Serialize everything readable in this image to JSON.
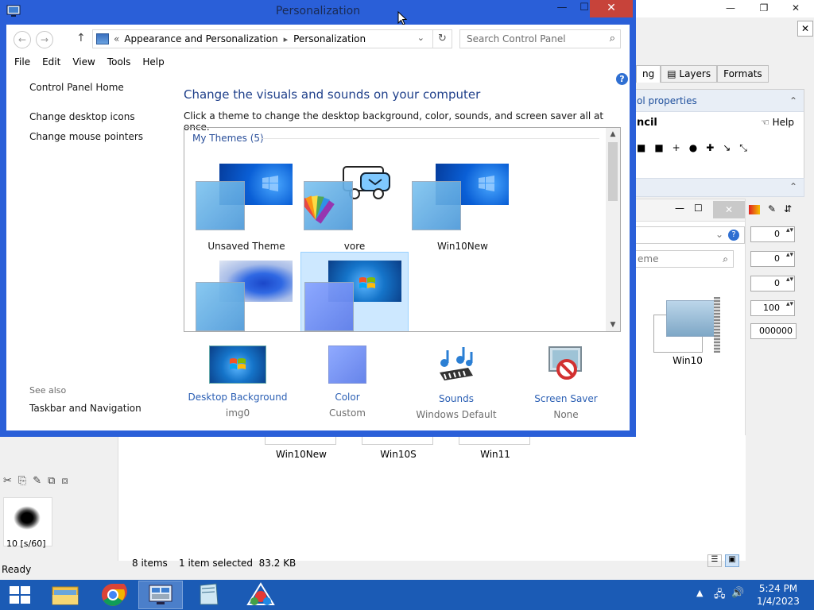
{
  "window": {
    "title": "Personalization",
    "minimize": "—",
    "maximize": "☐",
    "close": "✕"
  },
  "address": {
    "chevrons": "«",
    "crumbs": [
      "Appearance and Personalization",
      "Personalization"
    ],
    "separator": "▸",
    "search_placeholder": "Search Control Panel"
  },
  "menu": [
    "File",
    "Edit",
    "View",
    "Tools",
    "Help"
  ],
  "leftnav": {
    "home": "Control Panel Home",
    "links": [
      "Change desktop icons",
      "Change mouse pointers"
    ],
    "see_also": "See also",
    "see_also_link": "Taskbar and Navigation"
  },
  "main": {
    "heading": "Change the visuals and sounds on your computer",
    "subheading": "Click a theme to change the desktop background, color, sounds, and screen saver all at once.",
    "group_label": "My Themes (5)",
    "themes": [
      {
        "name": "Unsaved Theme"
      },
      {
        "name": "vore"
      },
      {
        "name": "Win10New"
      },
      {
        "name": ""
      },
      {
        "name": ""
      }
    ]
  },
  "bottom": [
    {
      "label": "Desktop Background",
      "sub": "img0"
    },
    {
      "label": "Color",
      "sub": "Custom"
    },
    {
      "label": "Sounds",
      "sub": "Windows Default"
    },
    {
      "label": "Screen Saver",
      "sub": "None"
    }
  ],
  "background_app": {
    "tabs": [
      "ng",
      "Layers",
      "Formats"
    ],
    "panel_title": "ol properties",
    "tool_name": "ncil",
    "help": "Help",
    "search_placeholder": "eme",
    "spin_values": [
      "0",
      "0",
      "0",
      "100"
    ],
    "hex": "000000",
    "thumb_label": "Win10",
    "explorer_items": [
      "Win10New",
      "Win10S",
      "Win11"
    ],
    "status_items": "8 items",
    "status_selected": "1 item selected  83.2 KB",
    "brush_label": "10 [s/60]",
    "ready": "Ready"
  },
  "taskbar": {
    "time": "5:24 PM",
    "date": "1/4/2023"
  },
  "colors": {
    "window_frame": "#2a5fd8",
    "close_red": "#c7433a",
    "link_blue": "#2b5fb4",
    "taskbar": "#1b5bb5"
  }
}
